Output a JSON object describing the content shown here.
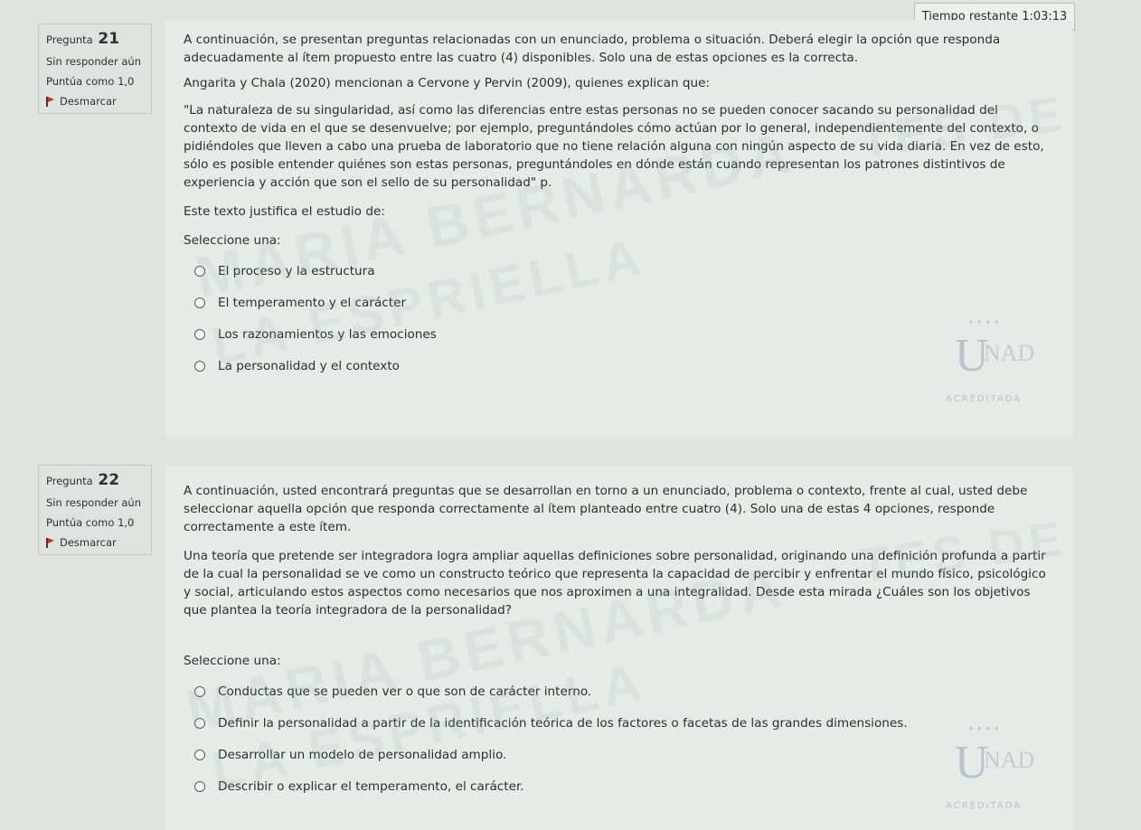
{
  "timer": {
    "label": "Tiempo restante",
    "value": "1:03:13"
  },
  "questions": [
    {
      "label": "Pregunta",
      "number": "21",
      "status": "Sin responder aún",
      "score": "Puntúa como 1,0",
      "flag_label": "Desmarcar",
      "intro": "A continuación, se presentan preguntas relacionadas con un enunciado, problema o situación. Deberá elegir la opción que responda adecuadamente al ítem propuesto entre las cuatro (4) disponibles. Solo una de estas opciones es la correcta.",
      "text1": "Angarita y Chala (2020) mencionan a Cervone y Pervin (2009), quienes explican que:",
      "text2": "\"La naturaleza de su singularidad, así como las diferencias entre estas personas no se pueden conocer sacando su personalidad del contexto de vida en el que se desenvuelve; por ejemplo, preguntándoles cómo actúan por lo general, independientemente del contexto, o pidiéndoles que lleven a cabo una prueba de laboratorio que no tiene relación alguna con ningún aspecto de su vida diaria. En vez de esto, sólo es posible entender quiénes son estas personas, preguntándoles en dónde están cuando representan los patrones distintivos de experiencia y acción que son el sello de su personalidad\" p.",
      "text3": "Este texto justifica el estudio de:",
      "select_label": "Seleccione una:",
      "options": [
        "El proceso y la estructura",
        "El temperamento y el carácter",
        "Los razonamientos y las emociones",
        "La personalidad y el contexto"
      ]
    },
    {
      "label": "Pregunta",
      "number": "22",
      "status": "Sin responder aún",
      "score": "Puntúa como 1,0",
      "flag_label": "Desmarcar",
      "intro": "A continuación, usted encontrará preguntas que se desarrollan en torno a un enunciado, problema o contexto, frente al cual, usted debe seleccionar aquella opción que responda correctamente al ítem planteado entre cuatro (4). Solo una de estas 4 opciones, responde correctamente a este ítem.",
      "text1": "Una teoría que pretende ser integradora logra ampliar aquellas definiciones sobre personalidad, originando una definición profunda a partir de la cual la personalidad se ve como un constructo teórico que representa la capacidad de percibir y enfrentar el mundo físico, psicológico y social, articulando estos aspectos como necesarios que nos aproximen a una integralidad. Desde esta mirada ¿Cuáles son los objetivos que plantea la teoría integradora de la personalidad?",
      "select_label": "Seleccione una:",
      "options": [
        "Conductas que se pueden ver o que son de carácter interno.",
        "Definir la personalidad a partir de la identificación teórica de los factores o facetas de las grandes dimensiones.",
        "Desarrollar un modelo de personalidad amplio.",
        "Describir o explicar el temperamento, el carácter."
      ]
    }
  ],
  "watermark": {
    "text1": "MARIA BERNARDA",
    "text2": "LA ESPRIELLA",
    "text3": "TES DE"
  },
  "logo": {
    "name": "unad-logo",
    "letter": "U",
    "rest": "NAD",
    "accredited": "ACREDITADA"
  },
  "colors": {
    "page_bg": "#dfe4e0",
    "content_bg": "#e6ebe7",
    "flag": "#b53a3a",
    "logo": "#465f8c"
  }
}
